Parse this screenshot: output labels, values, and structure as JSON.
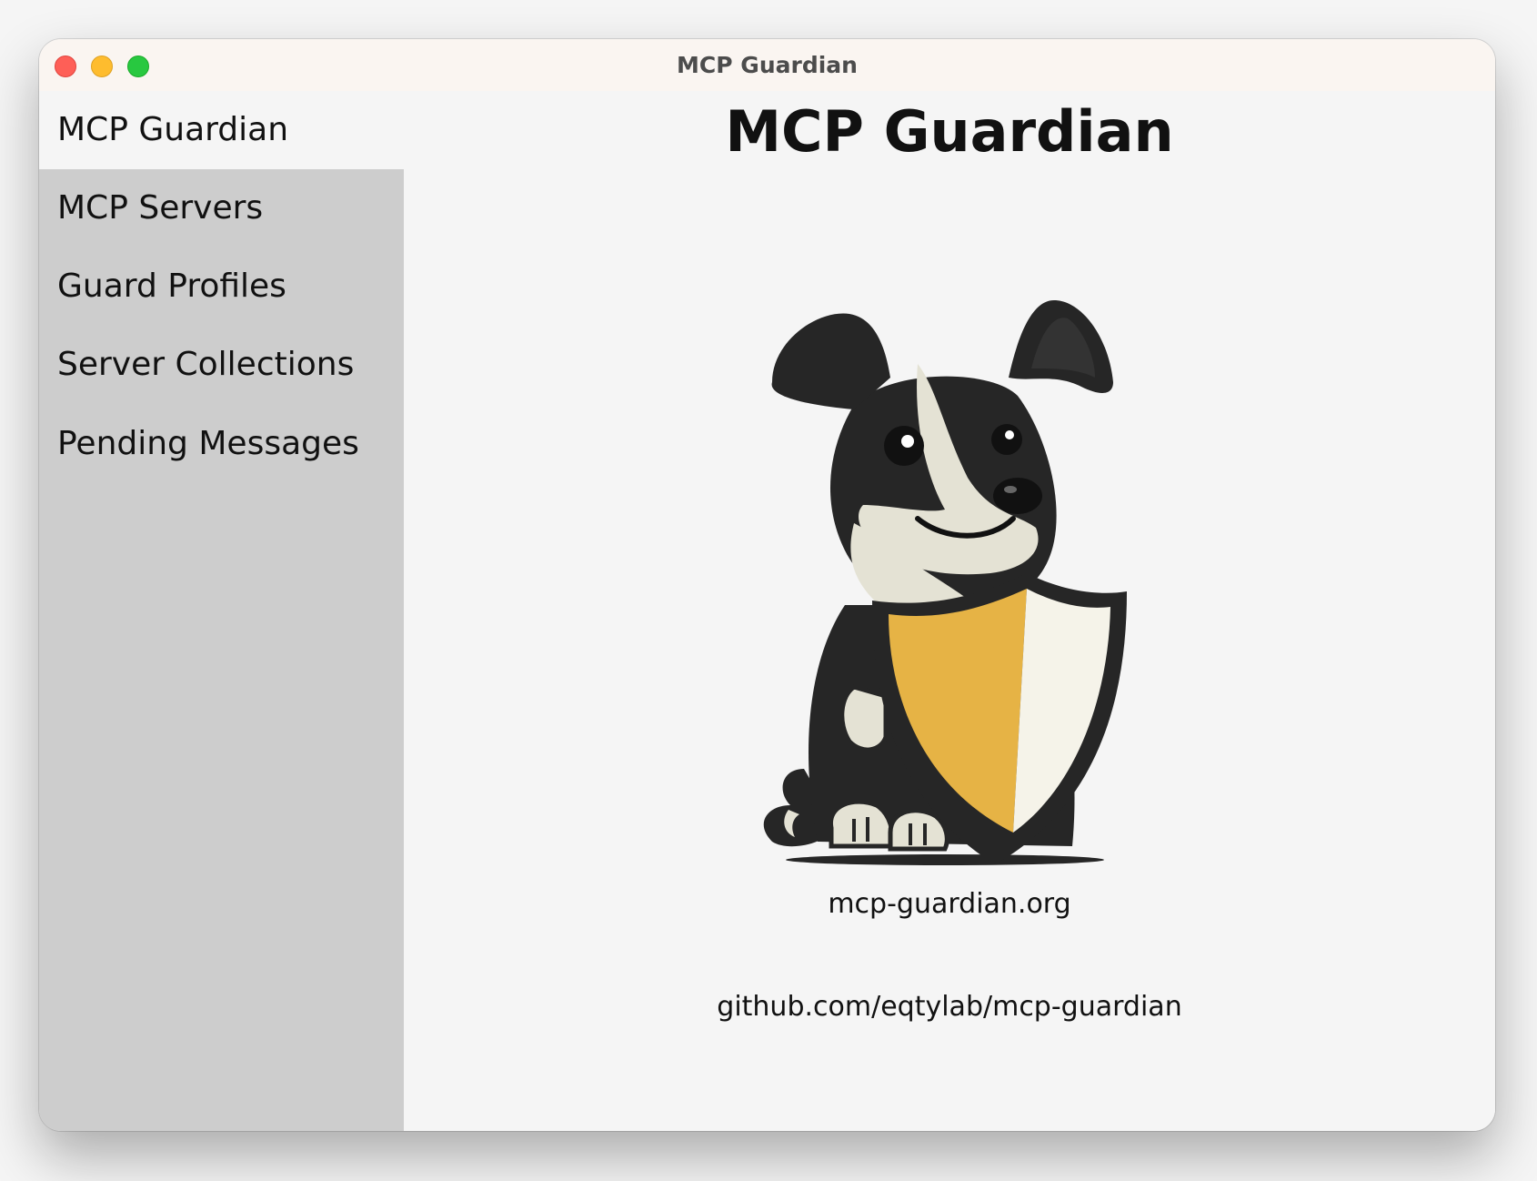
{
  "window": {
    "title": "MCP Guardian"
  },
  "sidebar": {
    "items": [
      {
        "label": "MCP Guardian",
        "active": true
      },
      {
        "label": "MCP Servers",
        "active": false
      },
      {
        "label": "Guard Profiles",
        "active": false
      },
      {
        "label": "Server Collections",
        "active": false
      },
      {
        "label": "Pending Messages",
        "active": false
      }
    ]
  },
  "main": {
    "title": "MCP Guardian",
    "logo_icon": "border-collie-with-shield",
    "links": {
      "website": "mcp-guardian.org",
      "github": "github.com/eqtylab/mcp-guardian"
    }
  },
  "colors": {
    "sidebar_bg": "#cdcdcd",
    "content_bg": "#f5f5f5",
    "titlebar_bg": "#faf5f1",
    "shield_gold": "#e6b345",
    "shield_white": "#f5f3e9",
    "dog_black": "#262626",
    "dog_cream": "#e4e2d4"
  }
}
